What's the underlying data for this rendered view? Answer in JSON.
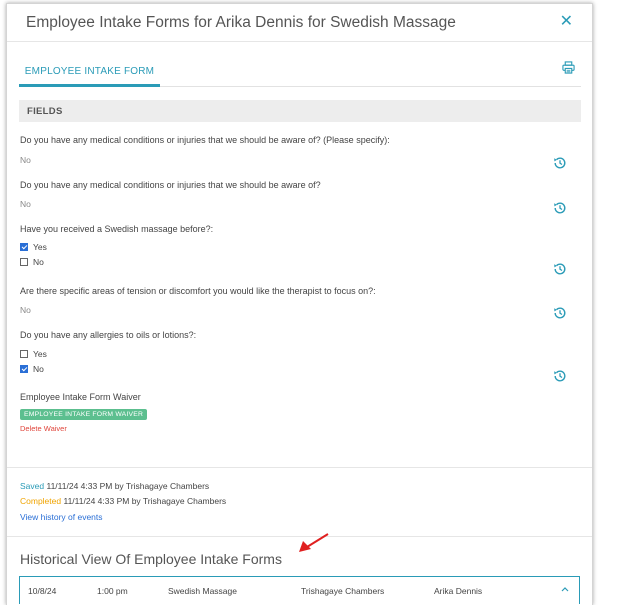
{
  "modal": {
    "title": "Employee Intake Forms for Arika Dennis for Swedish Massage",
    "close_glyph": "✕"
  },
  "tabs": [
    {
      "label": "EMPLOYEE INTAKE FORM",
      "active": true
    }
  ],
  "fields_header": "FIELDS",
  "questions": [
    {
      "label": "Do you have any medical conditions or injuries that we should be aware of? (Please specify):",
      "answer": "No"
    },
    {
      "label": "Do you have any medical conditions or injuries that we should be aware of?",
      "answer": "No"
    },
    {
      "label": "Have you received a Swedish massage before?:",
      "options": [
        {
          "label": "Yes",
          "checked": true
        },
        {
          "label": "No",
          "checked": false
        }
      ]
    },
    {
      "label": "Are there specific areas of tension or discomfort you would like the therapist to focus on?:",
      "answer": "No"
    },
    {
      "label": "Do you have any allergies to oils or lotions?:",
      "options": [
        {
          "label": "Yes",
          "checked": false
        },
        {
          "label": "No",
          "checked": true
        }
      ]
    },
    {
      "label": "Employee Intake Form Waiver"
    }
  ],
  "waiver": {
    "badge": "EMPLOYEE INTAKE FORM WAIVER",
    "delete_label": "Delete Waiver"
  },
  "status": {
    "saved_label": "Saved",
    "saved_text": "11/11/24 4:33 PM by Trishagaye Chambers",
    "completed_label": "Completed",
    "completed_text": "11/11/24 4:33 PM by Trishagaye Chambers",
    "view_history": "View history of events"
  },
  "historical": {
    "title": "Historical View Of Employee Intake Forms",
    "rows": [
      {
        "date": "10/8/24",
        "time": "1:00 pm",
        "service": "Swedish Massage",
        "employee": "Trishagaye Chambers",
        "client": "Arika Dennis"
      }
    ]
  },
  "colors": {
    "accent": "#2a9bb7",
    "checkbox": "#2a6fd6",
    "badge": "#5cbf8f",
    "danger": "#e0463c",
    "completed": "#f0a400",
    "annotation_arrow": "#e02020"
  }
}
